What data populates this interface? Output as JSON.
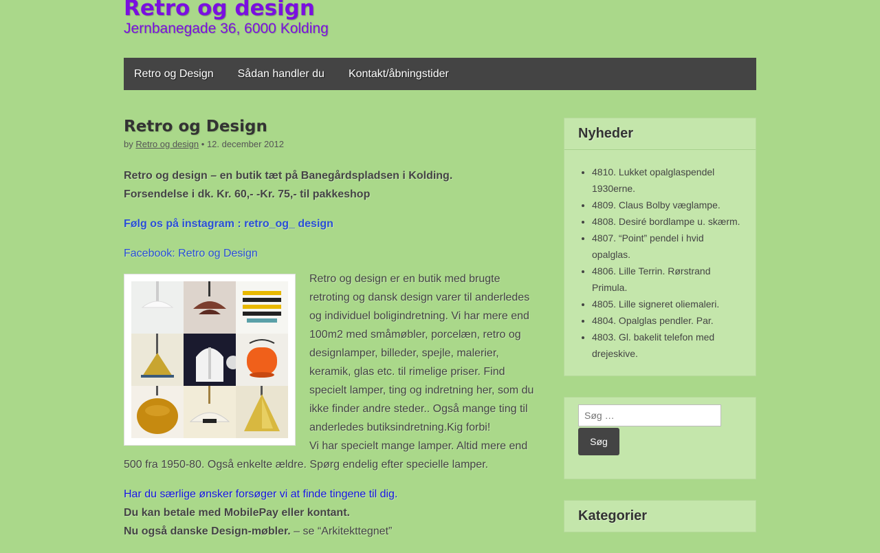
{
  "header": {
    "site_title": "Retro og design",
    "tagline": "Jernbanegade 36, 6000 Kolding"
  },
  "nav": {
    "items": [
      {
        "label": "Retro og Design"
      },
      {
        "label": "Sådan handler du"
      },
      {
        "label": "Kontakt/åbningstider"
      }
    ]
  },
  "post": {
    "title": "Retro og Design",
    "by": "by",
    "author": "Retro og design",
    "separator": "•",
    "date": "12. december 2012",
    "intro_line1": "Retro og design – en butik tæt på Banegårdspladsen i Kolding.",
    "intro_line2": "Forsendelse i dk. Kr. 60,-  -Kr. 75,- til pakkeshop",
    "instagram": "Følg os på instagram : retro_og_ design",
    "facebook": "Facebook: Retro og Design",
    "body1": "Retro og design er en butik med brugte retroting og dansk design varer til anderledes og individuel boligindretning. Vi har mere end 100m2 med småmøbler, porcelæn, retro og designlamper, billeder, spejle, malerier, keramik, glas etc. til rimelige priser. Find specielt lamper, ting og indretning her, som du ikke finder andre steder.. Også mange ting til anderledes butiksindretning.Kig forbi!",
    "body2": "Vi har specielt mange lamper. Altid mere end 500 fra 1950-80. Også enkelte ældre. Spørg endelig efter specielle lamper.",
    "wishes": "Har du særlige ønsker forsøger vi at finde tingene til dig.",
    "payment": "Du kan betale med MobilePay eller kontant.",
    "design_bold": "Nu også danske Design-møbler.",
    "design_rest": " – se “Arkitekttegnet”"
  },
  "sidebar": {
    "news_title": "Nyheder",
    "news": [
      "4810. Lukket opalglaspendel 1930erne.",
      "4809. Claus Bolby væglampe.",
      "4808. Desiré bordlampe u. skærm.",
      "4807. “Point” pendel i hvid opalglas.",
      "4806. Lille Terrin. Rørstrand Primula.",
      "4805. Lille signeret oliemaleri.",
      "4804. Opalglas pendler. Par.",
      "4803. Gl. bakelit telefon med drejeskive."
    ],
    "search_placeholder": "Søg …",
    "search_button": "Søg",
    "categories_title": "Kategorier"
  },
  "colors": {
    "background": "#aad88a",
    "title": "#7a10e0",
    "nav": "#444444",
    "widget": "#c4e6ab",
    "link": "#2a4fd6"
  }
}
